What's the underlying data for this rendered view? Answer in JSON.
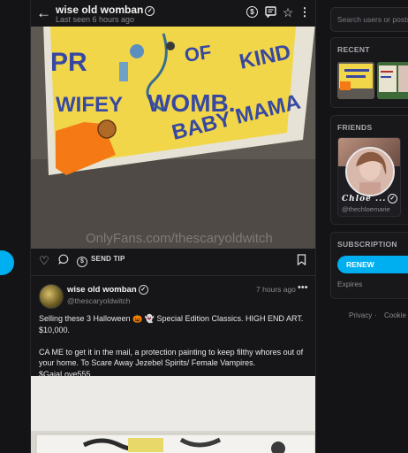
{
  "header": {
    "name": "wise old womban",
    "last_seen": "Last seen 6 hours ago",
    "icons": [
      "back-arrow-icon",
      "dollar-icon",
      "message-icon",
      "star-icon",
      "more-icon"
    ]
  },
  "post1": {
    "image_text": {
      "line1": "PR",
      "line2": "OF",
      "line3": "KIND",
      "line4": "WIFEY",
      "line5": "WOMB.",
      "line6": "BABY MAMA",
      "watermark": "OnlyFans.com/thescaryoldwitch"
    },
    "send_tip_label": "SEND TIP"
  },
  "post2": {
    "name": "wise old womban",
    "handle": "@thescaryoldwitch",
    "time": "7 hours ago",
    "text_p1": "Selling these 3 Halloween 🎃 👻 Special Edition Classics. HIGH END ART. $10,000.",
    "text_p2": "CA ME to get it in the mail, a protection painting to keep filthy whores out of your home. To Scare Away Jezebel Spirits/ Female Vampires. $GaiaLove555"
  },
  "sidebar": {
    "search_placeholder": "Search users or posts",
    "recent_title": "RECENT",
    "friends_title": "FRIENDS",
    "friend": {
      "name": "Chloe ...",
      "handle": "@thechloemarie"
    },
    "subscription_title": "SUBSCRIPTION",
    "renew_label": "RENEW",
    "expires_label": "Expires",
    "footer_privacy": "Privacy",
    "footer_dot": "·",
    "footer_cookie": "Cookie N"
  },
  "colors": {
    "accent": "#00aff0",
    "background": "#141416"
  }
}
